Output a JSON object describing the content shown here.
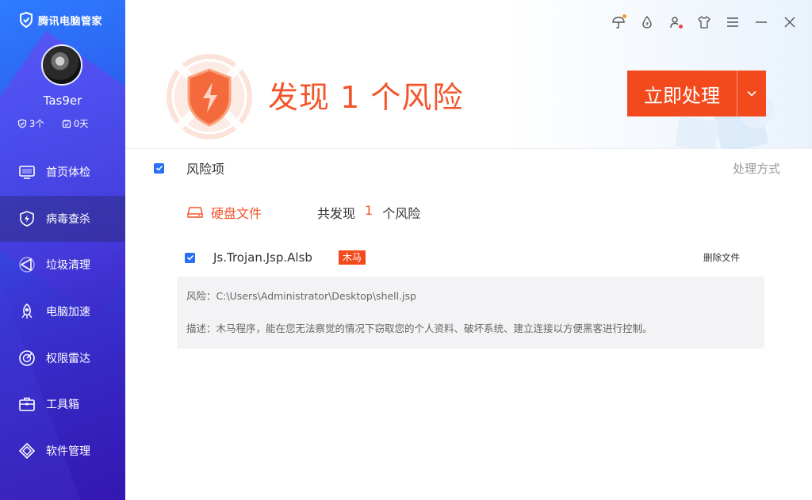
{
  "app": {
    "title": "腾讯电脑管家"
  },
  "user": {
    "name": "Tas9er",
    "risks_stat": "3个",
    "days_stat": "0天"
  },
  "nav": [
    {
      "label": "首页体检",
      "icon": "monitor-icon"
    },
    {
      "label": "病毒查杀",
      "icon": "lightning-shield-icon",
      "active": true
    },
    {
      "label": "垃圾清理",
      "icon": "broom-icon"
    },
    {
      "label": "电脑加速",
      "icon": "rocket-icon"
    },
    {
      "label": "权限雷达",
      "icon": "radar-icon"
    },
    {
      "label": "工具箱",
      "icon": "toolbox-icon"
    },
    {
      "label": "软件管理",
      "icon": "apps-icon"
    }
  ],
  "header": {
    "headline": "发现 1 个风险",
    "cta_label": "立即处理"
  },
  "list": {
    "header_title": "风险项",
    "header_right": "处理方式",
    "category": {
      "name": "硬盘文件",
      "summary_prefix": "共发现",
      "count": "1",
      "summary_suffix": "个风险"
    },
    "items": [
      {
        "name": "Js.Trojan.Jsp.Alsb",
        "tag": "木马",
        "action": "删除文件",
        "path": "风险：C:\\Users\\Administrator\\Desktop\\shell.jsp",
        "description": "描述：木马程序，能在您无法察觉的情况下窃取您的个人资料、破坏系统、建立连接以方便黑客进行控制。"
      }
    ]
  },
  "colors": {
    "accent": "#f24a1d",
    "checkbox": "#2a6ef5",
    "sidebar_top": "#2f7cff",
    "sidebar_bottom": "#3a1fb8"
  }
}
